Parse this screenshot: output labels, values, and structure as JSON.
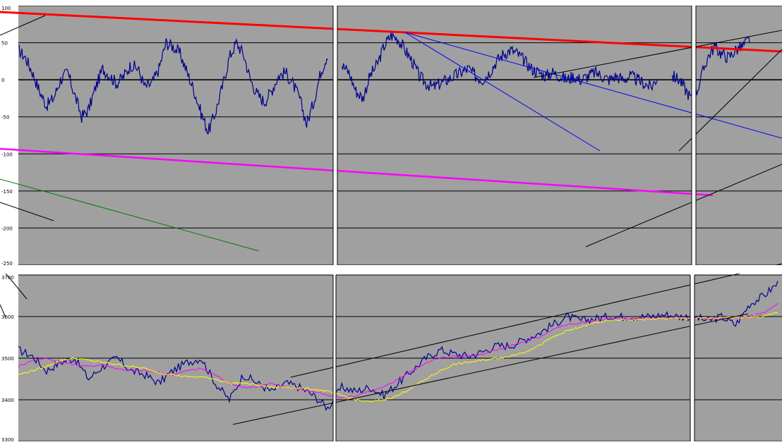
{
  "colors": {
    "plot_bg": "#a0a0a0",
    "price": "#00008b",
    "grid": "#000000",
    "trend_red": "#ff0000",
    "trend_magenta": "#ff00ff",
    "trend_blue": "#0000ff",
    "trend_green": "#008000",
    "trend_black": "#000000",
    "ma_fast": "#ff00ff",
    "ma_slow": "#ffff00",
    "separator": "#ffffff"
  },
  "chart_data": [
    {
      "type": "line",
      "panel": "oscillator",
      "title": "",
      "xlabel": "",
      "ylabel": "",
      "ylim": [
        -250,
        100
      ],
      "yticks": [
        100,
        50,
        0,
        -50,
        -100,
        -150,
        -200,
        -250
      ],
      "grid": true,
      "segments": 3,
      "x": [
        0,
        10,
        20,
        30,
        40,
        50,
        60,
        70,
        80,
        90,
        100,
        110,
        120,
        130,
        140,
        150,
        160,
        170,
        180,
        190,
        200,
        210,
        220,
        230,
        240,
        250,
        260,
        270,
        280,
        290,
        300,
        310,
        320,
        330,
        340,
        350,
        360,
        370,
        380,
        390,
        400,
        410,
        420,
        430,
        440,
        450,
        460,
        470,
        480,
        490,
        500,
        510,
        520,
        530,
        540,
        550,
        560,
        570,
        580,
        590,
        600,
        610,
        620,
        630,
        640,
        650,
        660,
        670,
        680,
        690,
        700,
        710,
        720,
        730,
        740,
        750,
        760,
        770,
        780,
        790,
        800,
        810,
        820,
        830,
        840,
        850,
        860,
        870,
        880,
        890,
        900,
        910,
        920,
        930,
        940,
        950,
        960,
        970,
        980,
        990,
        1000,
        1010,
        1020,
        1030,
        1040,
        1050,
        1060,
        1070,
        1080
      ],
      "series": [
        {
          "values": [
            40,
            30,
            10,
            -15,
            -35,
            -25,
            0,
            10,
            -20,
            -50,
            -40,
            -10,
            15,
            5,
            -5,
            5,
            20,
            15,
            -10,
            -5,
            15,
            50,
            45,
            35,
            10,
            -15,
            -45,
            -70,
            -45,
            -10,
            30,
            50,
            35,
            0,
            -20,
            -30,
            -15,
            5,
            10,
            -5,
            -25,
            -60,
            -30,
            10,
            35,
            null,
            20,
            10,
            -15,
            -25,
            5,
            20,
            45,
            60,
            55,
            40,
            25,
            5,
            -5,
            -10,
            -5,
            0,
            5,
            10,
            15,
            5,
            0,
            10,
            25,
            35,
            40,
            35,
            25,
            15,
            10,
            5,
            10,
            5,
            0,
            5,
            0,
            5,
            10,
            5,
            0,
            5,
            0,
            5,
            0,
            -5,
            -10,
            5,
            null,
            5,
            0,
            -15,
            -30,
            0,
            30,
            45,
            35,
            30,
            40,
            45,
            55,
            null,
            null,
            null,
            null
          ]
        }
      ]
    },
    {
      "type": "line",
      "panel": "price",
      "title": "",
      "xlabel": "",
      "ylabel": "",
      "ylim": [
        3300,
        3700
      ],
      "yticks": [
        3700,
        3600,
        3500,
        3400,
        3300
      ],
      "grid": true,
      "segments": 3,
      "x": [
        0,
        20,
        40,
        60,
        80,
        100,
        120,
        140,
        160,
        180,
        200,
        220,
        240,
        260,
        280,
        300,
        320,
        340,
        360,
        380,
        400,
        420,
        440,
        460,
        480,
        500,
        520,
        540,
        560,
        580,
        600,
        620,
        640,
        660,
        680,
        700,
        720,
        740,
        760,
        780,
        800,
        820,
        840,
        860,
        880,
        900,
        920,
        940,
        960,
        980,
        1000,
        1020,
        1040,
        1060,
        1080
      ],
      "series": [
        {
          "name": "",
          "values": [
            3520,
            3505,
            3470,
            3490,
            3500,
            3450,
            3480,
            3500,
            3470,
            3460,
            3440,
            3470,
            3490,
            3500,
            3440,
            3400,
            3460,
            3440,
            3420,
            3440,
            3430,
            3410,
            3380,
            3430,
            3420,
            3430,
            3410,
            3440,
            3470,
            3500,
            3520,
            3510,
            3505,
            3515,
            3530,
            3530,
            3545,
            3560,
            3580,
            3600,
            3590,
            3595,
            3600,
            3600,
            3600,
            3600,
            3605,
            3600,
            3600,
            3590,
            3600,
            3580,
            3630,
            3650,
            3680
          ]
        },
        {
          "name": "",
          "values": [
            3480,
            3495,
            3500,
            3490,
            3485,
            3480,
            3485,
            3475,
            3470,
            3470,
            3465,
            3460,
            3470,
            3475,
            3460,
            3440,
            3430,
            3430,
            3440,
            3430,
            3425,
            3420,
            3410,
            3405,
            3410,
            3420,
            3430,
            3450,
            3470,
            3490,
            3500,
            3505,
            3505,
            3510,
            3520,
            3530,
            3540,
            3550,
            3570,
            3580,
            3585,
            3590,
            3595,
            3595,
            3595,
            3595,
            3597,
            3598,
            3598,
            3595,
            3595,
            3600,
            3600,
            3610,
            3630
          ]
        },
        {
          "name": "",
          "values": [
            3460,
            3470,
            3480,
            3495,
            3500,
            3495,
            3490,
            3485,
            3480,
            3475,
            3465,
            3460,
            3455,
            3455,
            3450,
            3440,
            3440,
            3435,
            3430,
            3430,
            3428,
            3425,
            3420,
            3410,
            3400,
            3395,
            3400,
            3410,
            3430,
            3450,
            3470,
            3485,
            3490,
            3495,
            3500,
            3505,
            3515,
            3530,
            3550,
            3565,
            3575,
            3585,
            3590,
            3592,
            3593,
            3594,
            3595,
            3596,
            3596,
            3596,
            3597,
            3598,
            3600,
            3600,
            3610
          ]
        }
      ]
    }
  ]
}
